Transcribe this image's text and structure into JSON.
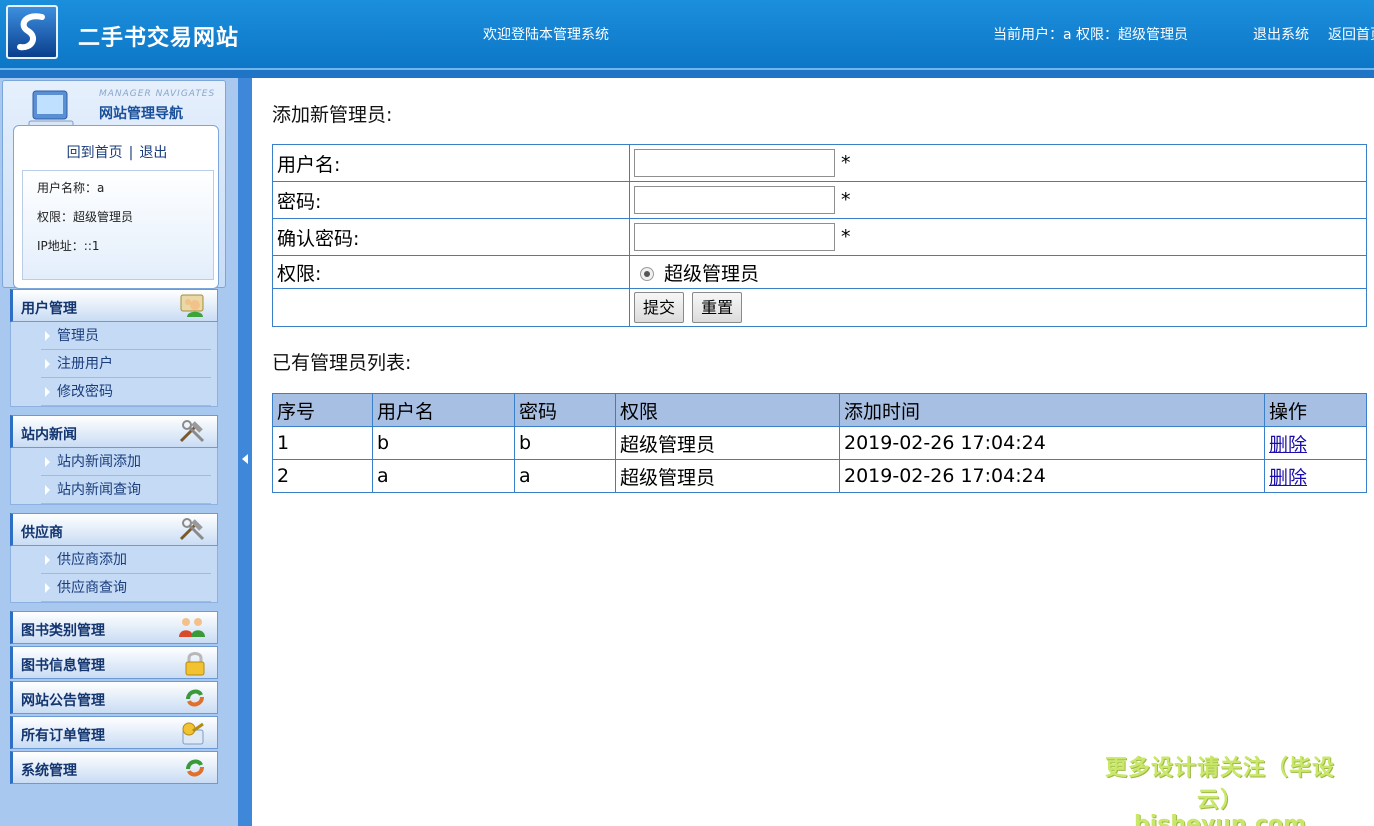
{
  "header": {
    "site_title": "二手书交易网站",
    "welcome": "欢迎登陆本管理系统",
    "current_user": "当前用户：a  权限：超级管理员",
    "logout": "退出系统",
    "home": "返回首页"
  },
  "sidebar": {
    "nav_en": "MANAGER NAVIGATES",
    "nav_title": "网站管理导航",
    "home_link": "回到首页",
    "separator": "|",
    "exit_link": "退出",
    "user_info": {
      "username": "用户名称：a",
      "permission": "权限：超级管理员",
      "ip": "IP地址：::1"
    },
    "groups": [
      {
        "label": "用户管理",
        "icon": "users-icon",
        "items": [
          "管理员",
          "注册用户",
          "修改密码"
        ]
      },
      {
        "label": "站内新闻",
        "icon": "tools-icon",
        "items": [
          "站内新闻添加",
          "站内新闻查询"
        ]
      },
      {
        "label": "供应商",
        "icon": "tools-icon",
        "items": [
          "供应商添加",
          "供应商查询"
        ]
      },
      {
        "label": "图书类别管理",
        "icon": "people-group-icon",
        "items": []
      },
      {
        "label": "图书信息管理",
        "icon": "lock-icon",
        "items": []
      },
      {
        "label": "网站公告管理",
        "icon": "refresh-icon",
        "items": []
      },
      {
        "label": "所有订单管理",
        "icon": "key-icon",
        "items": []
      },
      {
        "label": "系统管理",
        "icon": "refresh-icon",
        "items": []
      }
    ]
  },
  "form": {
    "title": "添加新管理员:",
    "username_label": "用户名:",
    "password_label": "密码:",
    "confirm_label": "确认密码:",
    "permission_label": "权限:",
    "required_mark": "*",
    "permission_option": "超级管理员",
    "username_value": "",
    "password_value": "",
    "confirm_value": "",
    "submit_label": "提交",
    "reset_label": "重置"
  },
  "list": {
    "title": "已有管理员列表:",
    "columns": [
      "序号",
      "用户名",
      "密码",
      "权限",
      "添加时间",
      "操作"
    ],
    "rows": [
      {
        "id": "1",
        "username": "b",
        "password": "b",
        "permission": "超级管理员",
        "time": "2019-02-26 17:04:24",
        "action": "删除"
      },
      {
        "id": "2",
        "username": "a",
        "password": "a",
        "permission": "超级管理员",
        "time": "2019-02-26 17:04:24",
        "action": "删除"
      }
    ]
  },
  "watermark": {
    "line1": "更多设计请关注（毕设云）",
    "line2": "bisheyun.com"
  }
}
